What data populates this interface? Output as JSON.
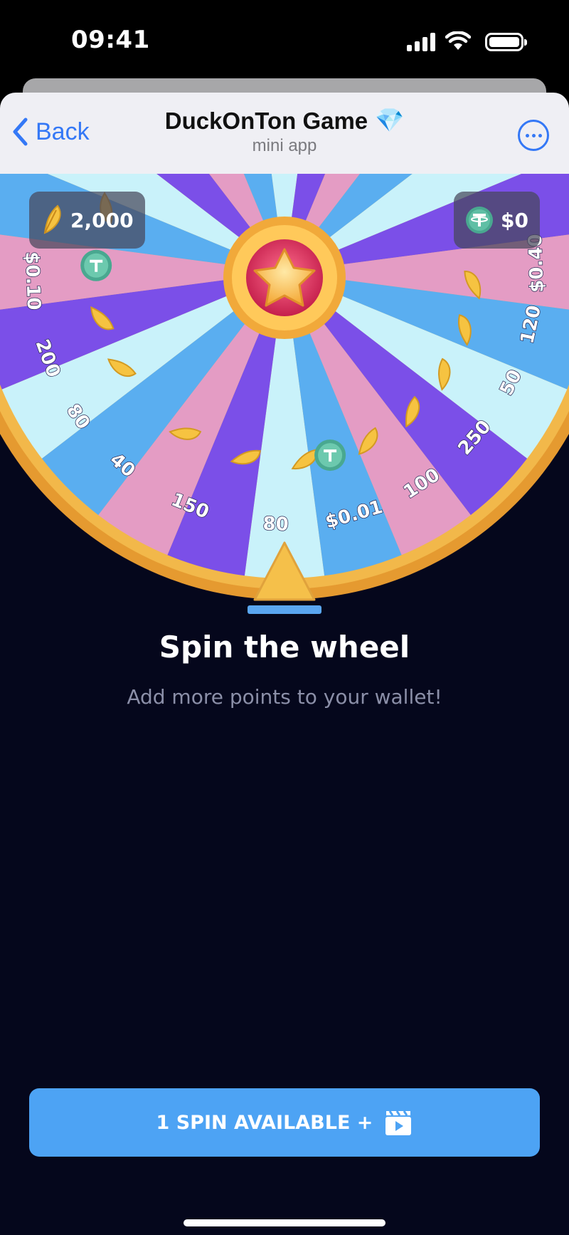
{
  "status": {
    "time": "09:41"
  },
  "nav": {
    "back_label": "Back",
    "title": "DuckOnTon Game",
    "title_emoji": "💎",
    "subtitle": "mini app"
  },
  "balances": {
    "points": "2,000",
    "usd": "$0"
  },
  "wheel": {
    "segment_labels": [
      "200",
      "80",
      "40",
      "150",
      "80",
      "$0.01",
      "100",
      "250",
      "50",
      "120",
      "$0.40",
      "$0.10"
    ]
  },
  "main": {
    "heading": "Spin the wheel",
    "subheading": "Add more points to your wallet!"
  },
  "spin": {
    "label": "1 SPIN AVAILABLE +"
  },
  "colors": {
    "accent": "#4da3f4",
    "background": "#05071c",
    "ios_blue": "#3478f6",
    "wheel_purple": "#7b4fe8",
    "wheel_blue": "#5aaef0",
    "wheel_pink": "#e49cc4",
    "wheel_light": "#c9f2fa",
    "wheel_gold": "#f0b94a"
  },
  "icons": {
    "back": "chevron-left-icon",
    "more": "more-icon",
    "points": "feather-icon",
    "usd": "tether-coin-icon",
    "spin": "clapperboard-icon",
    "hub": "star-icon",
    "pointer": "pointer-triangle-icon"
  }
}
